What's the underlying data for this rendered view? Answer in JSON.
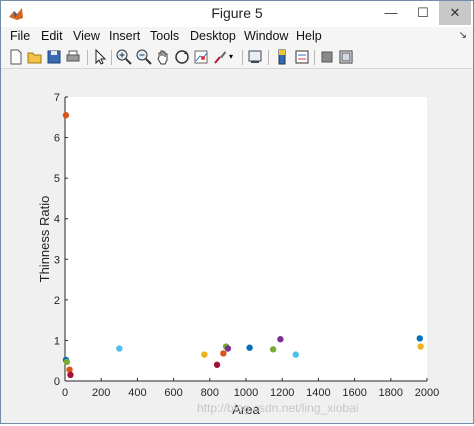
{
  "window": {
    "title": "Figure 5"
  },
  "controls": {
    "minimize": "—",
    "maximize": "☐",
    "close": "✕"
  },
  "menu": {
    "items": [
      {
        "label": "File",
        "name": "menu-file"
      },
      {
        "label": "Edit",
        "name": "menu-edit"
      },
      {
        "label": "View",
        "name": "menu-view"
      },
      {
        "label": "Insert",
        "name": "menu-insert"
      },
      {
        "label": "Tools",
        "name": "menu-tools"
      },
      {
        "label": "Desktop",
        "name": "menu-desktop"
      },
      {
        "label": "Window",
        "name": "menu-window"
      },
      {
        "label": "Help",
        "name": "menu-help"
      }
    ],
    "dock_arrow": "↘"
  },
  "toolbar": {
    "icons": [
      "new-figure-icon",
      "open-file-icon",
      "save-icon",
      "print-icon",
      "edit-plot-icon",
      "zoom-in-icon",
      "zoom-out-icon",
      "pan-icon",
      "rotate-3d-icon",
      "data-cursor-icon",
      "brush-icon",
      "link-plot-icon",
      "colorbar-icon",
      "legend-icon",
      "hide-plot-tools-icon",
      "show-plot-tools-icon"
    ]
  },
  "watermark": "http://blog.csdn.net/ling_xiobai",
  "chart_data": {
    "type": "scatter",
    "title": "",
    "xlabel": "Area",
    "ylabel": "Thinness Ratio",
    "xlim": [
      0,
      2000
    ],
    "ylim": [
      0,
      7
    ],
    "xticks": [
      0,
      200,
      400,
      600,
      800,
      1000,
      1200,
      1400,
      1600,
      1800,
      2000
    ],
    "yticks": [
      0,
      1,
      2,
      3,
      4,
      5,
      6,
      7
    ],
    "grid": false,
    "points": [
      {
        "x": 5,
        "y": 6.55,
        "color": "#D95319"
      },
      {
        "x": 5,
        "y": 0.52,
        "color": "#0072BD"
      },
      {
        "x": 10,
        "y": 0.47,
        "color": "#77AC30"
      },
      {
        "x": 25,
        "y": 0.28,
        "color": "#D95319"
      },
      {
        "x": 30,
        "y": 0.15,
        "color": "#A2142F"
      },
      {
        "x": 300,
        "y": 0.8,
        "color": "#4DBEEE"
      },
      {
        "x": 770,
        "y": 0.65,
        "color": "#EDB120"
      },
      {
        "x": 840,
        "y": 0.4,
        "color": "#A2142F"
      },
      {
        "x": 875,
        "y": 0.68,
        "color": "#D95319"
      },
      {
        "x": 890,
        "y": 0.85,
        "color": "#77AC30"
      },
      {
        "x": 900,
        "y": 0.8,
        "color": "#7E2F8E"
      },
      {
        "x": 1020,
        "y": 0.82,
        "color": "#0072BD"
      },
      {
        "x": 1150,
        "y": 0.78,
        "color": "#77AC30"
      },
      {
        "x": 1190,
        "y": 1.03,
        "color": "#7E2F8E"
      },
      {
        "x": 1275,
        "y": 0.65,
        "color": "#4DBEEE"
      },
      {
        "x": 1960,
        "y": 1.05,
        "color": "#0072BD"
      },
      {
        "x": 1965,
        "y": 0.85,
        "color": "#EDB120"
      }
    ]
  }
}
